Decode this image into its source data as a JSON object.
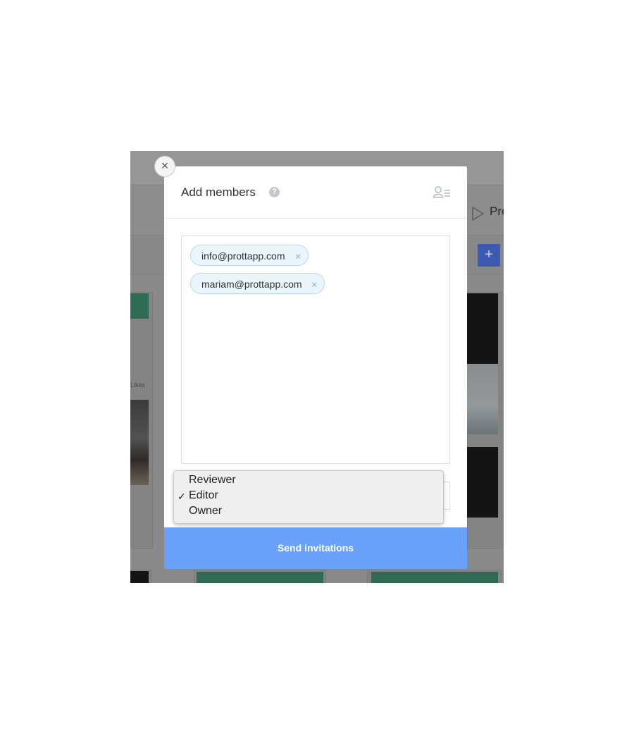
{
  "modal": {
    "title": "Add members",
    "help_icon": "question-circle-icon",
    "members_icon": "member-list-icon",
    "close_icon": "close-icon",
    "close_glyph": "×",
    "emails": [
      {
        "label": "info@prottapp.com",
        "remove_glyph": "×"
      },
      {
        "label": "mariam@prottapp.com",
        "remove_glyph": "×"
      }
    ],
    "send_label": "Send invitations",
    "send_color": "#6aa2fb",
    "chip_color": "#eaf5fc"
  },
  "role_dropdown": {
    "options": [
      "Reviewer",
      "Editor",
      "Owner"
    ],
    "selected": "Editor",
    "check_glyph": "✓"
  },
  "background": {
    "preview_label": "Pre",
    "add_glyph": "+",
    "likes_label": "Likes",
    "add_button_color": "#3b5ab0"
  }
}
